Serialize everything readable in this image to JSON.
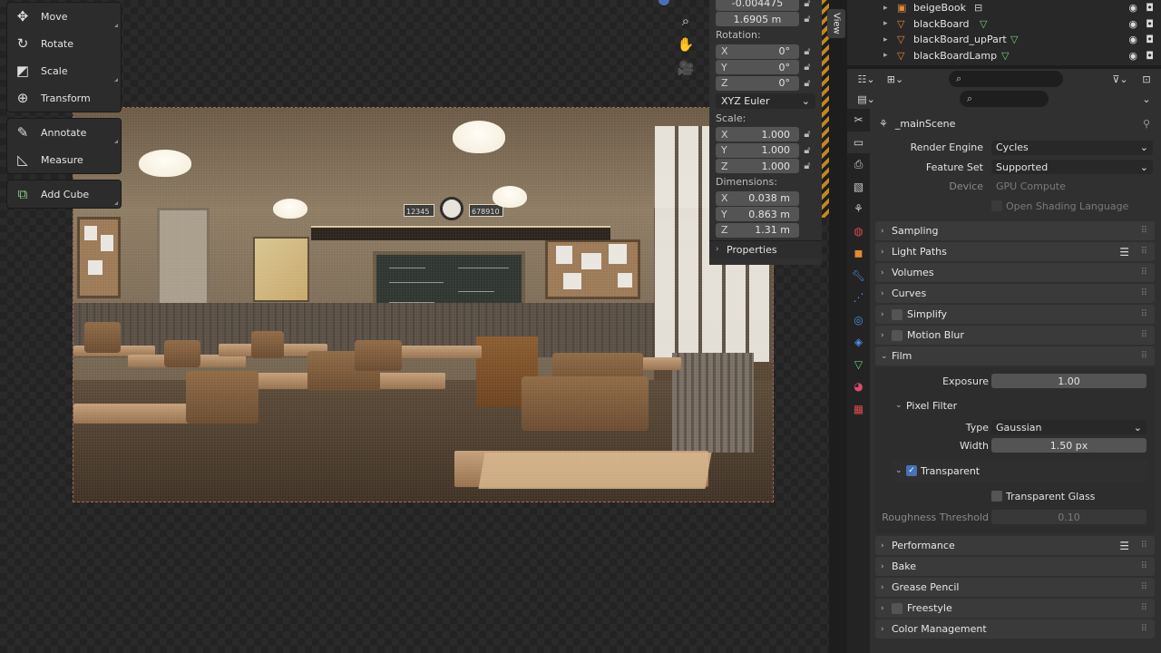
{
  "toolbar": {
    "groups": [
      [
        {
          "label": "Move",
          "icon": "move-icon"
        },
        {
          "label": "Rotate",
          "icon": "rotate-icon"
        },
        {
          "label": "Scale",
          "icon": "scale-icon"
        },
        {
          "label": "Transform",
          "icon": "transform-icon"
        }
      ],
      [
        {
          "label": "Annotate",
          "icon": "annotate-icon"
        },
        {
          "label": "Measure",
          "icon": "measure-icon"
        }
      ],
      [
        {
          "label": "Add Cube",
          "icon": "add-cube-icon"
        }
      ]
    ]
  },
  "render": {
    "numcard_left": "12345",
    "numcard_right": "678910"
  },
  "npanel": {
    "location_partial": [
      "-0.004475",
      "1.6905 m"
    ],
    "rotation_label": "Rotation:",
    "rotation": [
      {
        "axis": "X",
        "value": "0°"
      },
      {
        "axis": "Y",
        "value": "0°"
      },
      {
        "axis": "Z",
        "value": "0°"
      }
    ],
    "rotation_mode": "XYZ Euler",
    "scale_label": "Scale:",
    "scale": [
      {
        "axis": "X",
        "value": "1.000"
      },
      {
        "axis": "Y",
        "value": "1.000"
      },
      {
        "axis": "Z",
        "value": "1.000"
      }
    ],
    "dimensions_label": "Dimensions:",
    "dimensions": [
      {
        "axis": "X",
        "value": "0.038 m"
      },
      {
        "axis": "Y",
        "value": "0.863 m"
      },
      {
        "axis": "Z",
        "value": "1.31 m"
      }
    ],
    "properties_label": "Properties",
    "view_tab": "View"
  },
  "outliner": {
    "items": [
      "beigeBook",
      "blackBoard",
      "blackBoard_upPart",
      "blackBoardLamp"
    ]
  },
  "properties": {
    "scene_name": "_mainScene",
    "render_engine_label": "Render Engine",
    "render_engine": "Cycles",
    "feature_set_label": "Feature Set",
    "feature_set": "Supported",
    "device_label": "Device",
    "device": "GPU Compute",
    "osl_label": "Open Shading Language",
    "panels_top": [
      "Sampling",
      "Light Paths",
      "Volumes",
      "Curves",
      "Simplify",
      "Motion Blur"
    ],
    "film_label": "Film",
    "exposure_label": "Exposure",
    "exposure": "1.00",
    "pixel_filter_label": "Pixel Filter",
    "type_label": "Type",
    "type": "Gaussian",
    "width_label": "Width",
    "width": "1.50 px",
    "transparent_label": "Transparent",
    "transparent_glass_label": "Transparent Glass",
    "roughness_label": "Roughness Threshold",
    "roughness": "0.10",
    "panels_bottom": [
      "Performance",
      "Bake",
      "Grease Pencil",
      "Freestyle",
      "Color Management"
    ]
  }
}
